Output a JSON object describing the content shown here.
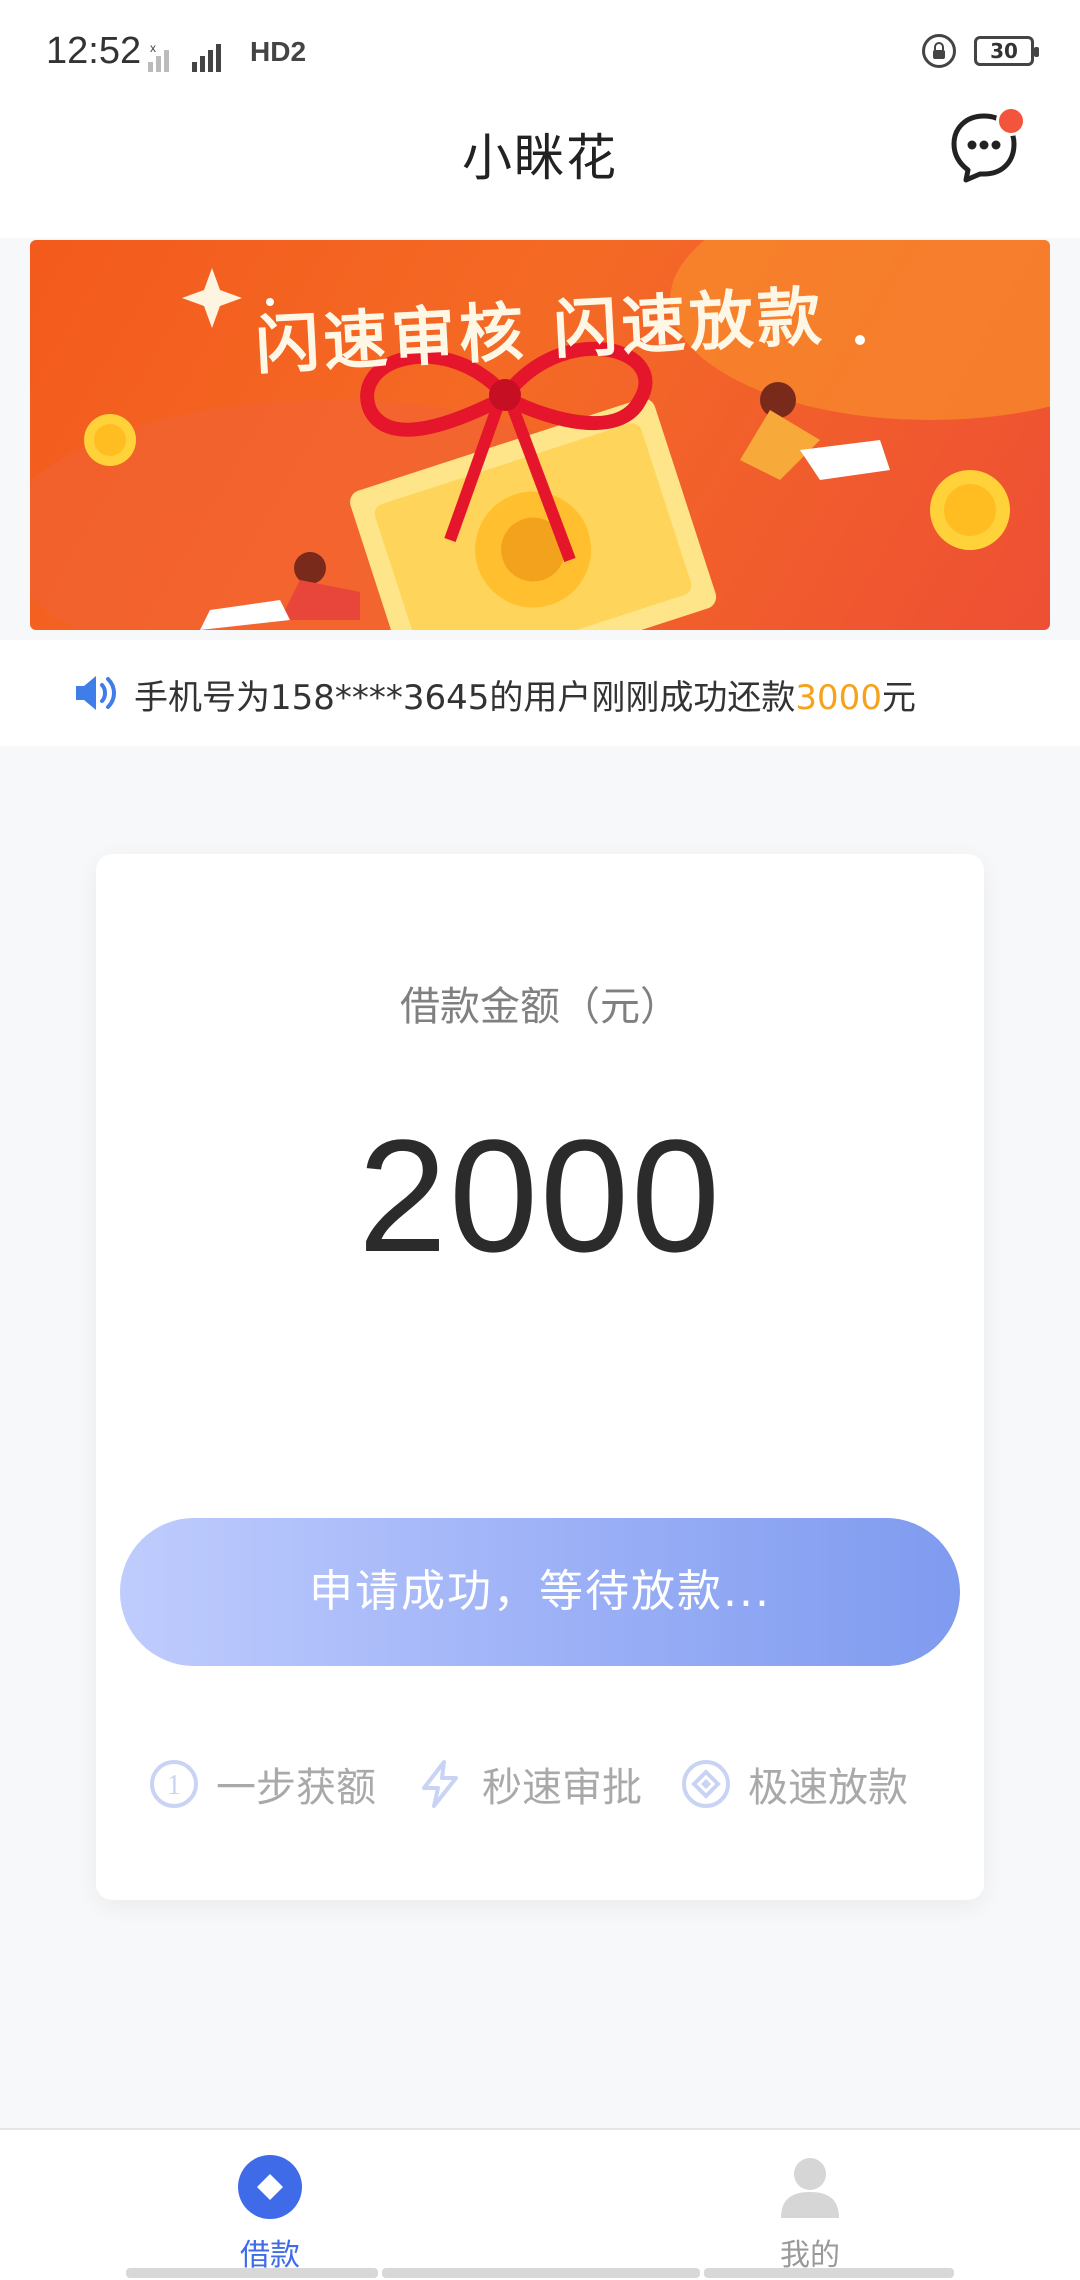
{
  "status_bar": {
    "time": "12:52",
    "network": "4G",
    "hd": "HD2",
    "battery": "30"
  },
  "header": {
    "title": "小眯花",
    "message_icon": "chat-bubble-icon"
  },
  "banner": {
    "headline": "闪速审核 闪速放款"
  },
  "notice": {
    "icon": "speaker-icon",
    "prefix": "手机号为158****3645的用户刚刚成功还款",
    "amount": "3000",
    "suffix": "元"
  },
  "loan_card": {
    "label": "借款金额（元）",
    "amount": "2000",
    "button_label": "申请成功，等待放款...",
    "features": [
      {
        "icon": "number-one-circle-icon",
        "label": "一步获额"
      },
      {
        "icon": "lightning-icon",
        "label": "秒速审批"
      },
      {
        "icon": "diamond-circle-icon",
        "label": "极速放款"
      }
    ]
  },
  "tabbar": {
    "items": [
      {
        "label": "借款",
        "icon": "loan-diamond-icon",
        "active": true
      },
      {
        "label": "我的",
        "icon": "user-icon",
        "active": false
      }
    ]
  },
  "colors": {
    "accent_blue": "#3f6be8",
    "button_gradient_start": "#bfccfd",
    "button_gradient_end": "#7f9bef",
    "highlight_amount": "#f7a21b",
    "banner_orange": "#f35a1c",
    "badge_red": "#f2553b"
  }
}
